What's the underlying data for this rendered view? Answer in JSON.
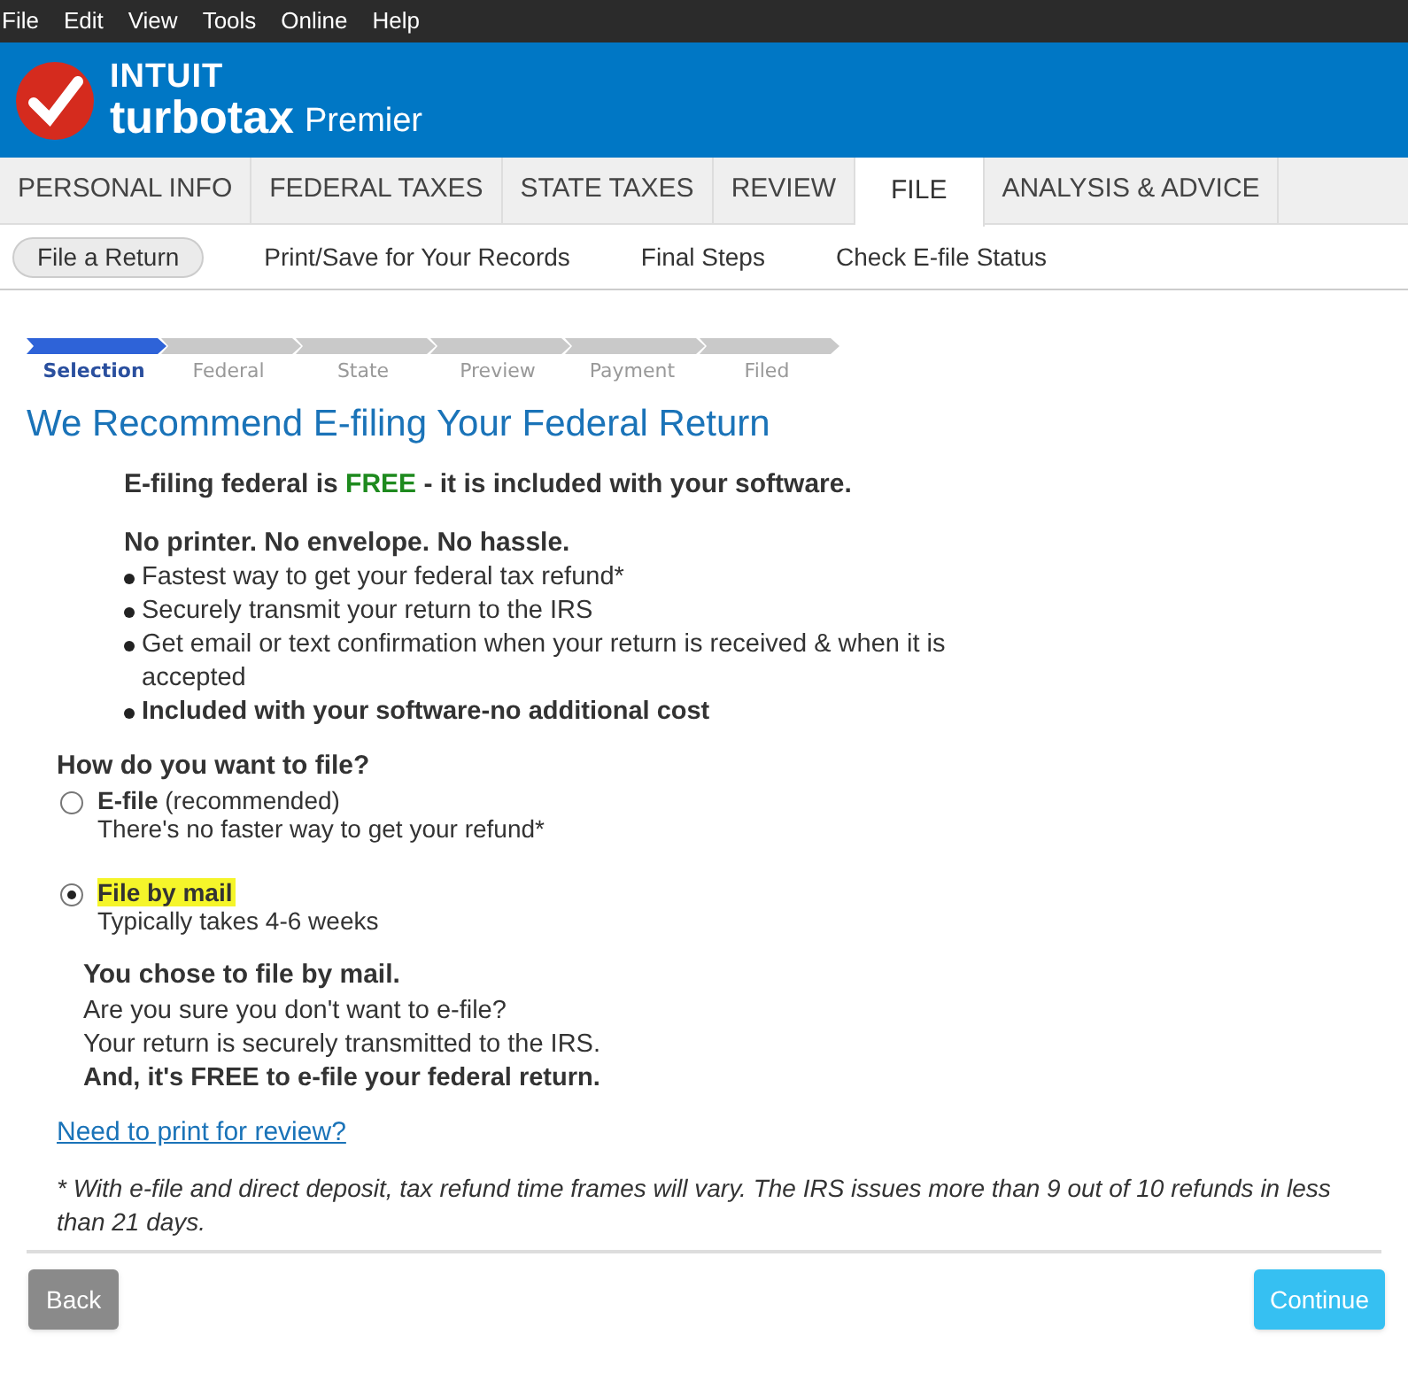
{
  "menu_bar": [
    "File",
    "Edit",
    "View",
    "Tools",
    "Online",
    "Help"
  ],
  "brand": {
    "company": "INTUIT",
    "product": "turbotax",
    "edition": "Premier"
  },
  "tabs": [
    {
      "label": "PERSONAL INFO",
      "selected": false
    },
    {
      "label": "FEDERAL TAXES",
      "selected": false
    },
    {
      "label": "STATE TAXES",
      "selected": false
    },
    {
      "label": "REVIEW",
      "selected": false
    },
    {
      "label": "FILE",
      "selected": true
    },
    {
      "label": "ANALYSIS & ADVICE",
      "selected": false
    }
  ],
  "subtabs": [
    {
      "label": "File a Return",
      "selected": true
    },
    {
      "label": "Print/Save for Your Records",
      "selected": false
    },
    {
      "label": "Final Steps",
      "selected": false
    },
    {
      "label": "Check E-file Status",
      "selected": false
    }
  ],
  "steps": [
    {
      "label": "Selection",
      "selected": true
    },
    {
      "label": "Federal",
      "selected": false
    },
    {
      "label": "State",
      "selected": false
    },
    {
      "label": "Preview",
      "selected": false
    },
    {
      "label": "Payment",
      "selected": false
    },
    {
      "label": "Filed",
      "selected": false
    }
  ],
  "heading": "We Recommend E-filing Your Federal Return",
  "intro": [
    {
      "text": "E-filing federal is ",
      "emphasis": false
    },
    {
      "text": "FREE",
      "emphasis": true
    },
    {
      "text": " - it is included with your software.",
      "emphasis": false
    }
  ],
  "benefits_title": "No printer. No envelope. No hassle.",
  "benefits": [
    {
      "text": "Fastest way to get your federal tax refund*",
      "bold": false
    },
    {
      "text": "Securely transmit your return to the IRS",
      "bold": false
    },
    {
      "text": "Get email or text confirmation when your return is received & when it is accepted",
      "bold": false
    },
    {
      "text": "Included with your software-no additional cost",
      "bold": true
    }
  ],
  "question": "How do you want to file?",
  "options": [
    {
      "label": "**E-file** (recommended)",
      "hint": "There's no faster way to get your refund*",
      "selected": false
    },
    {
      "label": "**File by mail**",
      "hint": "Typically takes 4-6 weeks",
      "selected": true
    }
  ],
  "confirmation": {
    "title": "You chose to file by mail.",
    "lines": [
      {
        "text": "Are you sure you don't want to e-file?",
        "bold": false
      },
      {
        "text": "Your return is securely transmitted to the IRS.",
        "bold": false
      },
      {
        "text": "And, it's FREE to e-file your federal return.",
        "bold": true
      }
    ]
  },
  "link": "Need to print for review?",
  "footnote": "* With e-file and direct deposit, tax refund time frames will vary. The IRS issues more than 9 out of 10 refunds in less than 21 days.",
  "buttons": {
    "back": "Back",
    "continue": "Continue"
  }
}
